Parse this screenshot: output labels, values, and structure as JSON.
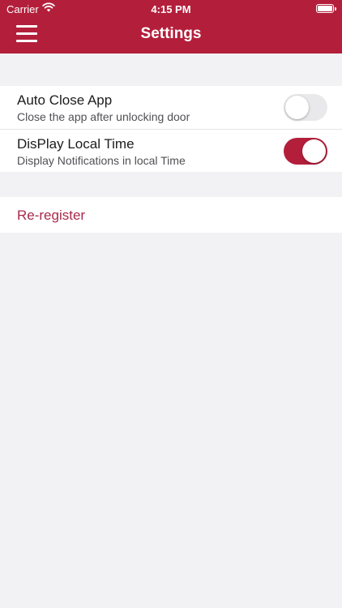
{
  "status_bar": {
    "carrier": "Carrier",
    "time": "4:15 PM"
  },
  "header": {
    "title": "Settings",
    "menu_icon": "hamburger-menu-icon"
  },
  "colors": {
    "accent": "#b31f3b",
    "background": "#f2f2f4",
    "link": "#a8294a"
  },
  "settings": {
    "auto_close": {
      "label": "Auto Close App",
      "description": "Close the app after unlocking door",
      "enabled": false
    },
    "local_time": {
      "label": "DisPlay Local Time",
      "description": "Display Notifications in local Time",
      "enabled": true
    }
  },
  "actions": {
    "reregister_label": "Re-register"
  }
}
